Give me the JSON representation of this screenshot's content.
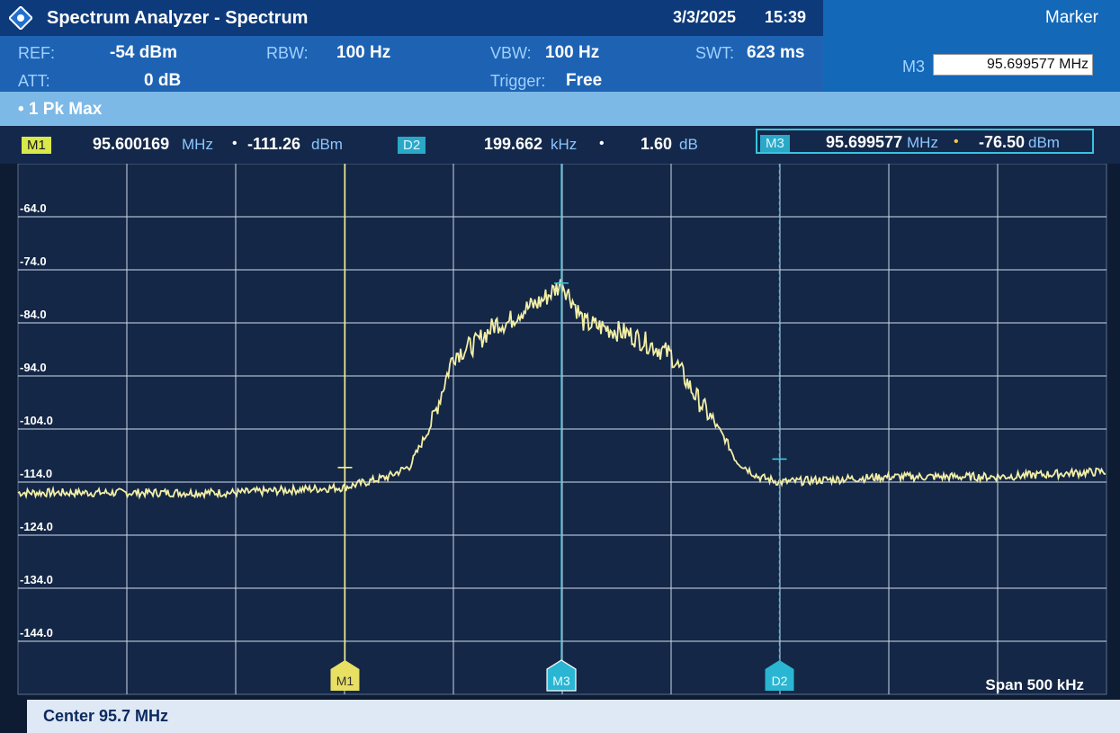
{
  "title_bar": {
    "app_title": "Spectrum Analyzer - Spectrum",
    "date": "3/3/2025",
    "time": "15:39",
    "panel_title": "Marker"
  },
  "settings": {
    "ref_label": "REF:",
    "ref_value": "-54 dBm",
    "att_label": "ATT:",
    "att_value": "0 dB",
    "rbw_label": "RBW:",
    "rbw_value": "100 Hz",
    "vbw_label": "VBW:",
    "vbw_value": "100 Hz",
    "trigger_label": "Trigger:",
    "trigger_value": "Free",
    "swt_label": "SWT:",
    "swt_value": "623 ms"
  },
  "marker_panel": {
    "marker_label": "M3",
    "frequency_value": "95.699577 MHz"
  },
  "trace": {
    "label": "• 1 Pk  Max"
  },
  "markers": {
    "m1": {
      "tag": "M1",
      "freq": "95.600169",
      "freq_unit": "MHz",
      "level": "-111.26",
      "level_unit": "dBm",
      "color": "#f5f27a"
    },
    "d2": {
      "tag": "D2",
      "freq": "199.662",
      "freq_unit": "kHz",
      "level": "1.60",
      "level_unit": "dB",
      "color": "#3cc8e0"
    },
    "m3": {
      "tag": "M3",
      "freq": "95.699577",
      "freq_unit": "MHz",
      "level": "-76.50",
      "level_unit": "dBm",
      "color": "#3cc8e0"
    }
  },
  "chart_data": {
    "type": "line",
    "y_tick_labels": [
      "-64.0",
      "-74.0",
      "-84.0",
      "-94.0",
      "-104.0",
      "-114.0",
      "-124.0",
      "-134.0",
      "-144.0"
    ],
    "ylim": [
      -154,
      -54
    ],
    "xlim_khz": [
      -250,
      250
    ],
    "grid": true,
    "trace_color": "#f3efa6",
    "x_offset_khz": [
      -250,
      -200,
      -150,
      -100,
      -80,
      -70,
      -60,
      -50,
      -40,
      -30,
      -25,
      -20,
      -10,
      0,
      5,
      10,
      20,
      30,
      40,
      50,
      60,
      70,
      75,
      80,
      90,
      100,
      150,
      200,
      250
    ],
    "level_dbm": [
      -116,
      -116,
      -116,
      -115,
      -113,
      -111,
      -103,
      -90,
      -88,
      -84,
      -84,
      -82,
      -80,
      -76.5,
      -80,
      -84,
      -85,
      -86,
      -88,
      -90,
      -97,
      -103,
      -106,
      -110,
      -113,
      -114,
      -113,
      -113,
      -112
    ],
    "marker_positions_khz": {
      "M1": -99.8,
      "M3": -0.4,
      "D2": 99.8
    }
  },
  "footer": {
    "span": "Span 500 kHz",
    "center": "Center 95.7 MHz"
  }
}
